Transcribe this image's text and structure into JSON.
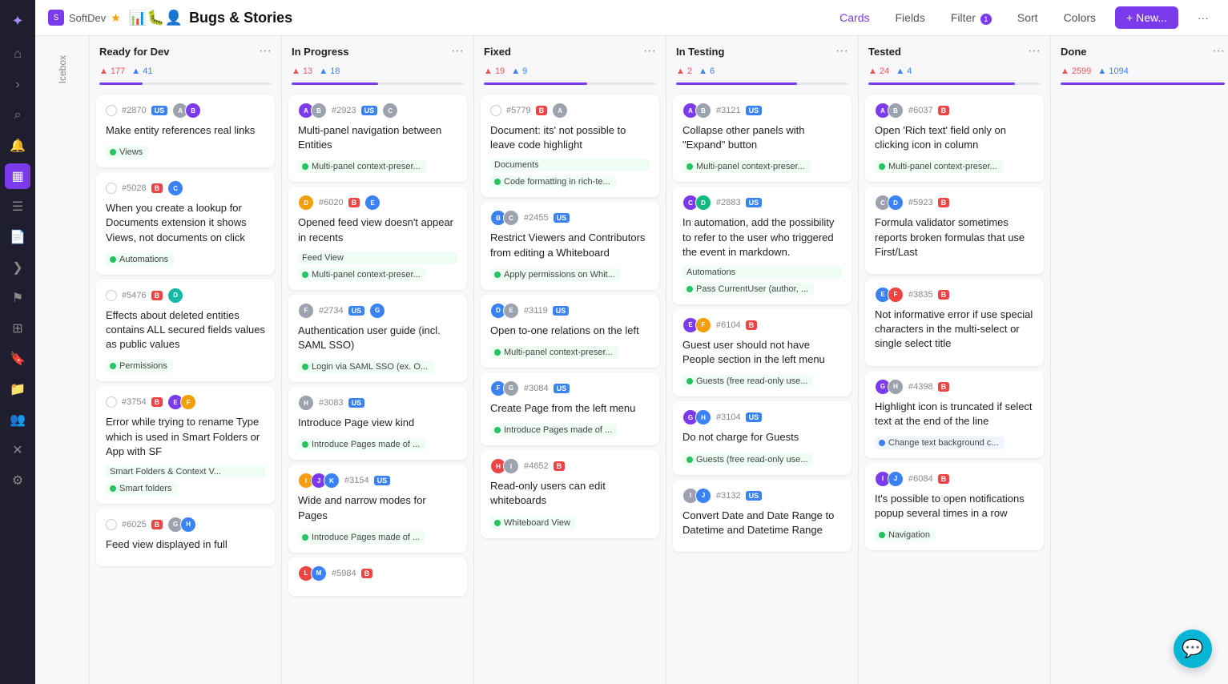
{
  "app": {
    "name": "SoftDev",
    "star": "★",
    "board_title": "Bugs & Stories"
  },
  "topbar": {
    "cards_label": "Cards",
    "fields_label": "Fields",
    "filter_label": "Filter",
    "filter_count": "1",
    "sort_label": "Sort",
    "colors_label": "Colors",
    "new_label": "+ New...",
    "more_icon": "···"
  },
  "columns": [
    {
      "id": "icebox",
      "title": "Icebox",
      "is_icebox": true
    },
    {
      "id": "ready_for_dev",
      "title": "Ready for Dev",
      "count_up": 177,
      "count_down": 41,
      "progress": 25,
      "cards": [
        {
          "id": "2870",
          "tag": "US",
          "avatars": [
            "av-gray",
            "av-purple"
          ],
          "title": "Make entity references real links",
          "labels": [
            {
              "text": "Views",
              "color": "green"
            }
          ]
        },
        {
          "id": "5028",
          "tag": "B",
          "avatars": [
            "av-blue"
          ],
          "title": "When you create a lookup for Documents extension it shows Views, not documents on click",
          "labels": [
            {
              "text": "Automations",
              "color": "green"
            }
          ]
        },
        {
          "id": "5476",
          "tag": "B",
          "avatars": [
            "av-teal"
          ],
          "title": "Effects about deleted entities contains ALL secured fields values as public values",
          "labels": [
            {
              "text": "Permissions",
              "color": "green"
            }
          ]
        },
        {
          "id": "3754",
          "tag": "B",
          "avatars": [
            "av-purple",
            "av-orange"
          ],
          "title": "Error while trying to rename Type which is used in Smart Folders or App with SF",
          "labels": [
            {
              "text": "Smart Folders & Context V...",
              "color": "green"
            },
            {
              "text": "Smart folders",
              "color": "green"
            }
          ]
        },
        {
          "id": "6025",
          "tag": "B",
          "avatars": [
            "av-gray",
            "av-blue"
          ],
          "title": "Feed view displayed in full",
          "labels": []
        }
      ]
    },
    {
      "id": "in_progress",
      "title": "In Progress",
      "count_up": 13,
      "count_down": 18,
      "progress": 50,
      "cards": [
        {
          "id": "2923",
          "tag": "US",
          "avatars": [
            "av-purple",
            "av-gray"
          ],
          "title": "Multi-panel navigation between Entities",
          "labels": [
            {
              "text": "Multi-panel context-preser...",
              "color": "green"
            }
          ]
        },
        {
          "id": "6020",
          "tag": "B",
          "avatars": [
            "av-orange",
            "av-blue"
          ],
          "title": "Opened feed view doesn't appear in recents",
          "labels": [
            {
              "text": "Feed View",
              "color": "green"
            },
            {
              "text": "Multi-panel context-preser...",
              "color": "green"
            }
          ]
        },
        {
          "id": "2734",
          "tag": "US",
          "avatars": [
            "av-purple",
            "av-blue"
          ],
          "title": "Authentication user guide (incl. SAML SSO)",
          "labels": [
            {
              "text": "Login via SAML SSO (ex. O...",
              "color": "green"
            }
          ]
        },
        {
          "id": "3083",
          "tag": "US",
          "avatars": [
            "av-gray"
          ],
          "title": "Introduce Page view kind",
          "labels": [
            {
              "text": "Introduce Pages made of ...",
              "color": "green"
            }
          ]
        },
        {
          "id": "3154",
          "tag": "US",
          "avatars": [
            "av-orange",
            "av-purple",
            "av-blue"
          ],
          "title": "Wide and narrow modes for Pages",
          "labels": [
            {
              "text": "Introduce Pages made of ...",
              "color": "green"
            }
          ]
        },
        {
          "id": "5984",
          "tag": "B",
          "avatars": [
            "av-red",
            "av-blue"
          ],
          "title": "",
          "labels": []
        }
      ]
    },
    {
      "id": "fixed",
      "title": "Fixed",
      "count_up": 19,
      "count_down": 9,
      "progress": 60,
      "cards": [
        {
          "id": "5779",
          "tag": "B",
          "avatars": [
            "av-gray"
          ],
          "title": "Document: its' not possible to leave code highlight",
          "labels": [
            {
              "text": "Documents",
              "color": "green"
            },
            {
              "text": "Code formatting in rich-te...",
              "color": "green"
            }
          ]
        },
        {
          "id": "2455",
          "tag": "US",
          "avatars": [
            "av-blue",
            "av-gray"
          ],
          "title": "Restrict Viewers and Contributors from editing a Whiteboard",
          "labels": [
            {
              "text": "Apply permissions on Whit...",
              "color": "green"
            }
          ]
        },
        {
          "id": "3119",
          "tag": "US",
          "avatars": [
            "av-blue",
            "av-gray"
          ],
          "title": "Open to-one relations on the left",
          "labels": [
            {
              "text": "Multi-panel context-preser...",
              "color": "green"
            }
          ]
        },
        {
          "id": "3084",
          "tag": "US",
          "avatars": [
            "av-blue",
            "av-gray"
          ],
          "title": "Create Page from the left menu",
          "labels": [
            {
              "text": "Introduce Pages made of ...",
              "color": "green"
            }
          ]
        },
        {
          "id": "4652",
          "tag": "B",
          "avatars": [
            "av-gray"
          ],
          "title": "Read-only users can edit whiteboards",
          "labels": [
            {
              "text": "Whiteboard View",
              "color": "green"
            }
          ]
        }
      ]
    },
    {
      "id": "in_testing",
      "title": "In Testing",
      "count_up": 2,
      "count_down": 6,
      "progress": 70,
      "cards": [
        {
          "id": "3121",
          "tag": "US",
          "avatars": [
            "av-purple",
            "av-gray"
          ],
          "title": "Collapse other panels with \"Expand\" button",
          "labels": [
            {
              "text": "Multi-panel context-preser...",
              "color": "green"
            }
          ]
        },
        {
          "id": "2883",
          "tag": "US",
          "avatars": [
            "av-purple",
            "av-green"
          ],
          "title": "In automation, add the possibility to refer to the user who triggered the event in markdown.",
          "labels": [
            {
              "text": "Automations",
              "color": "green"
            },
            {
              "text": "Pass CurrentUser (author, ...",
              "color": "green"
            }
          ]
        },
        {
          "id": "6104",
          "tag": "B",
          "avatars": [
            "av-purple",
            "av-orange"
          ],
          "title": "Guest user should not have People section in the left menu",
          "labels": [
            {
              "text": "Guests (free read-only use...",
              "color": "green"
            }
          ]
        },
        {
          "id": "3104",
          "tag": "US",
          "avatars": [
            "av-purple",
            "av-blue"
          ],
          "title": "Do not charge for Guests",
          "labels": [
            {
              "text": "Guests (free read-only use...",
              "color": "green"
            }
          ]
        },
        {
          "id": "3132",
          "tag": "US",
          "avatars": [
            "av-gray",
            "av-blue"
          ],
          "title": "Convert Date and Date Range to Datetime and Datetime Range",
          "labels": []
        }
      ]
    },
    {
      "id": "tested",
      "title": "Tested",
      "count_up": 24,
      "count_down": 4,
      "progress": 85,
      "cards": [
        {
          "id": "6037",
          "tag": "B",
          "avatars": [
            "av-purple",
            "av-gray"
          ],
          "title": "Open 'Rich text' field only on clicking icon in column",
          "labels": [
            {
              "text": "Multi-panel context-preser...",
              "color": "green"
            }
          ]
        },
        {
          "id": "5923",
          "tag": "B",
          "avatars": [
            "av-gray",
            "av-blue"
          ],
          "title": "Formula validator sometimes reports broken formulas that use First/Last",
          "labels": []
        },
        {
          "id": "3835",
          "tag": "B",
          "avatars": [
            "av-blue",
            "av-red"
          ],
          "title": "Not informative error if use special characters in the multi-select or single select title",
          "labels": []
        },
        {
          "id": "4398",
          "tag": "B",
          "avatars": [
            "av-purple",
            "av-gray"
          ],
          "title": "Highlight icon is truncated if select text at the end of the line",
          "labels": [
            {
              "text": "Change text background c...",
              "color": "blue"
            }
          ]
        },
        {
          "id": "6084",
          "tag": "B",
          "avatars": [
            "av-purple",
            "av-blue"
          ],
          "title": "It's possible to open notifications popup several times in a row",
          "labels": [
            {
              "text": "Navigation",
              "color": "green"
            }
          ]
        }
      ]
    },
    {
      "id": "done",
      "title": "Done",
      "count_up": 2599,
      "count_down": 1094,
      "progress": 100,
      "cards": []
    }
  ],
  "chat_button": "💬"
}
